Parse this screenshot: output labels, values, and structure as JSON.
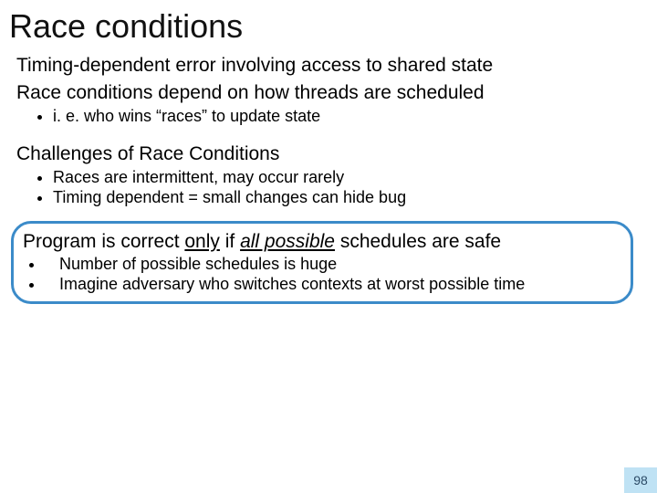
{
  "title": "Race conditions",
  "section1": {
    "para1": "Timing-dependent error involving access to shared state",
    "para2": "Race conditions depend on how threads are scheduled",
    "bullets": [
      "i. e. who wins “races” to update state"
    ]
  },
  "section2": {
    "heading": "Challenges of Race Conditions",
    "bullets": [
      "Races are intermittent, may occur rarely",
      "Timing dependent = small changes can hide bug"
    ]
  },
  "section3": {
    "line_pre": "Program is correct ",
    "line_only": "only",
    "line_mid": " if ",
    "line_all_possible": "all possible",
    "line_post": " schedules are safe",
    "bullets": [
      "Number of possible schedules is huge",
      "Imagine adversary who switches contexts at worst possible time"
    ]
  },
  "page_number": "98"
}
